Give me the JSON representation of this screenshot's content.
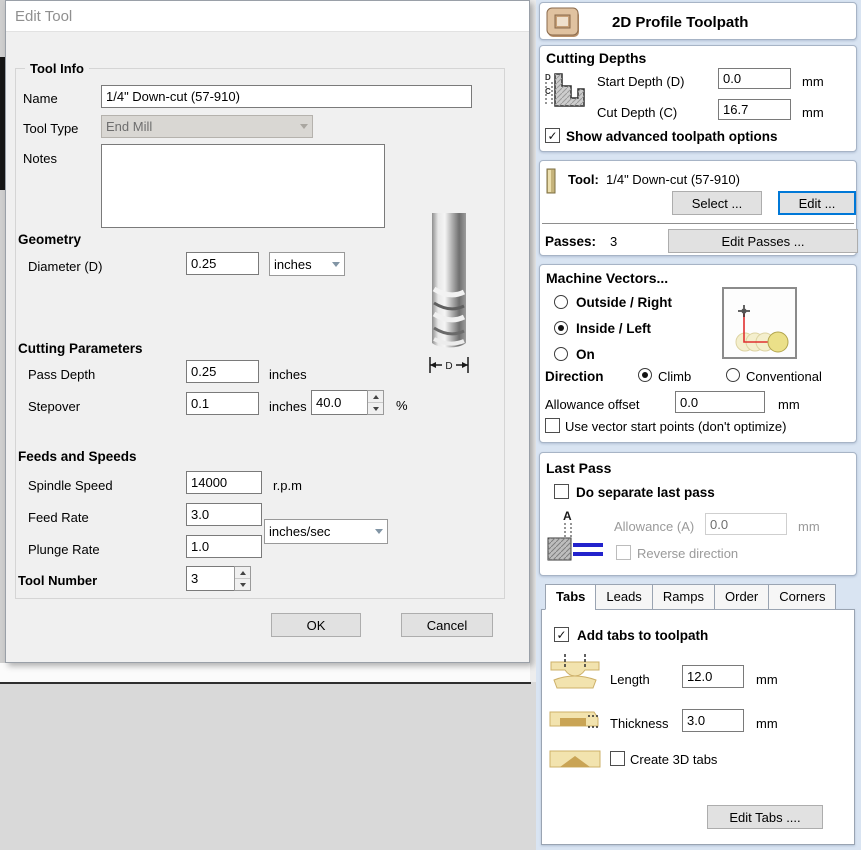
{
  "dialog": {
    "title": "Edit Tool",
    "group_label": "Tool Info",
    "fields": {
      "name": {
        "label": "Name",
        "value": "1/4\" Down-cut (57-910)"
      },
      "tool_type": {
        "label": "Tool Type",
        "value": "End Mill"
      },
      "notes": {
        "label": "Notes",
        "value": ""
      }
    },
    "geometry": {
      "heading": "Geometry",
      "diameter_label": "Diameter (D)",
      "diameter_value": "0.25",
      "units": "inches"
    },
    "tool_image": {
      "dim_label": "D"
    },
    "cutting_params": {
      "heading": "Cutting Parameters",
      "pass_depth_label": "Pass Depth",
      "pass_depth_value": "0.25",
      "pass_depth_units": "inches",
      "stepover_label": "Stepover",
      "stepover_value": "0.1",
      "stepover_units": "inches",
      "stepover_percent": "40.0",
      "percent_sign": "%"
    },
    "feeds": {
      "heading": "Feeds and Speeds",
      "spindle_label": "Spindle Speed",
      "spindle_value": "14000",
      "spindle_units": "r.p.m",
      "feed_label": "Feed Rate",
      "feed_value": "3.0",
      "plunge_label": "Plunge Rate",
      "plunge_value": "1.0",
      "rate_units": "inches/sec"
    },
    "tool_number": {
      "label": "Tool Number",
      "value": "3"
    },
    "buttons": {
      "ok": "OK",
      "cancel": "Cancel"
    }
  },
  "panel": {
    "header": {
      "title": "2D Profile Toolpath"
    },
    "cutting_depths": {
      "heading": "Cutting Depths",
      "start_label": "Start Depth (D)",
      "start_value": "0.0",
      "start_units": "mm",
      "cut_label": "Cut Depth (C)",
      "cut_value": "16.7",
      "cut_units": "mm",
      "advanced_label": "Show advanced toolpath options"
    },
    "tool": {
      "label": "Tool:",
      "value": "1/4\" Down-cut (57-910)",
      "select_button": "Select ...",
      "edit_button": "Edit ...",
      "passes_label": "Passes:",
      "passes_value": "3",
      "edit_passes_button": "Edit Passes ..."
    },
    "machine_vectors": {
      "heading": "Machine Vectors...",
      "options": [
        {
          "label": "Outside / Right",
          "selected": false
        },
        {
          "label": "Inside / Left",
          "selected": true
        },
        {
          "label": "On",
          "selected": false
        }
      ],
      "direction_label": "Direction",
      "climb_label": "Climb",
      "conventional_label": "Conventional",
      "allowance_label": "Allowance offset",
      "allowance_value": "0.0",
      "allowance_units": "mm",
      "start_points_label": "Use vector start points (don't optimize)"
    },
    "last_pass": {
      "heading": "Last Pass",
      "separate_label": "Do separate last pass",
      "icon_letter": "A",
      "allowance_label": "Allowance (A)",
      "allowance_value": "0.0",
      "allowance_units": "mm",
      "reverse_label": "Reverse direction"
    },
    "tabs_section": {
      "tabs": [
        "Tabs",
        "Leads",
        "Ramps",
        "Order",
        "Corners"
      ],
      "add_tabs_label": "Add tabs to toolpath",
      "length_label": "Length",
      "length_value": "12.0",
      "length_units": "mm",
      "thickness_label": "Thickness",
      "thickness_value": "3.0",
      "thickness_units": "mm",
      "create3d_label": "Create 3D tabs",
      "edit_tabs_button": "Edit Tabs ...."
    }
  },
  "colors": {
    "accent_blue": "#0078d7",
    "panel_bg": "#d9e4f2",
    "tab_tan": "#f2e3ae"
  }
}
